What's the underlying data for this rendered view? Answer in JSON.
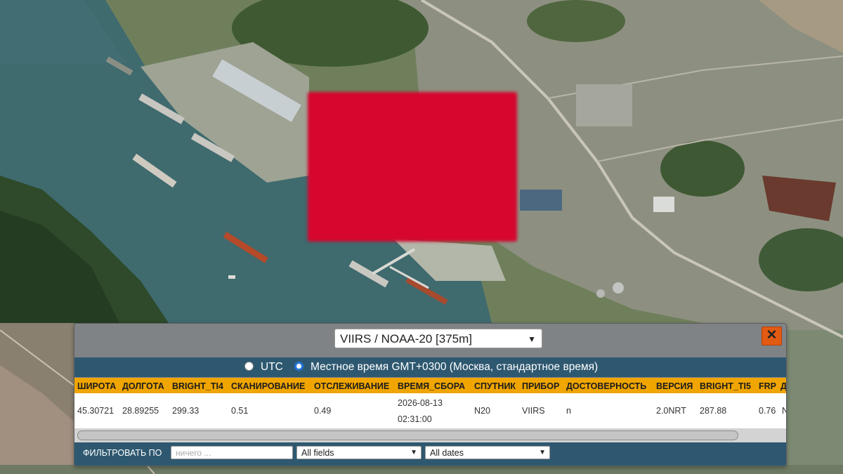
{
  "panel": {
    "sensor_select": "VIIRS / NOAA-20 [375m]",
    "close_symbol": "✕",
    "timezone": {
      "utc_label": "UTC",
      "local_label": "Местное время GMT+0300 (Москва, стандартное время)",
      "selected": "local"
    },
    "columns": [
      "ШИРОТА",
      "ДОЛГОТА",
      "BRIGHT_TI4",
      "СКАНИРОВАНИЕ",
      "ОТСЛЕЖИВАНИЕ",
      "ВРЕМЯ_СБОРА",
      "СПУТНИК",
      "ПРИБОР",
      "ДОСТОВЕРНОСТЬ",
      "ВЕРСИЯ",
      "BRIGHT_TI5",
      "FRP",
      "Д"
    ],
    "row": {
      "lat": "45.30721",
      "lon": "28.89255",
      "bright_ti4": "299.33",
      "scan": "0.51",
      "track": "0.49",
      "acq_date": "2026-08-13",
      "acq_time": "02:31:00",
      "satellite": "N20",
      "instrument": "VIIRS",
      "confidence": "n",
      "version": "2.0NRT",
      "bright_ti5": "287.88",
      "frp": "0.76",
      "daynight": "N"
    },
    "filter": {
      "label": "ФИЛЬТРОВАТЬ ПО",
      "input_placeholder": "ничего ...",
      "fields_select": "All fields",
      "dates_select": "All dates"
    }
  },
  "colors": {
    "river": "#3f6a6e",
    "fire_overlay": "#d6062f",
    "header_bar": "#f0a500",
    "panel_dark": "#2e5870",
    "close_button": "#e35b13"
  }
}
